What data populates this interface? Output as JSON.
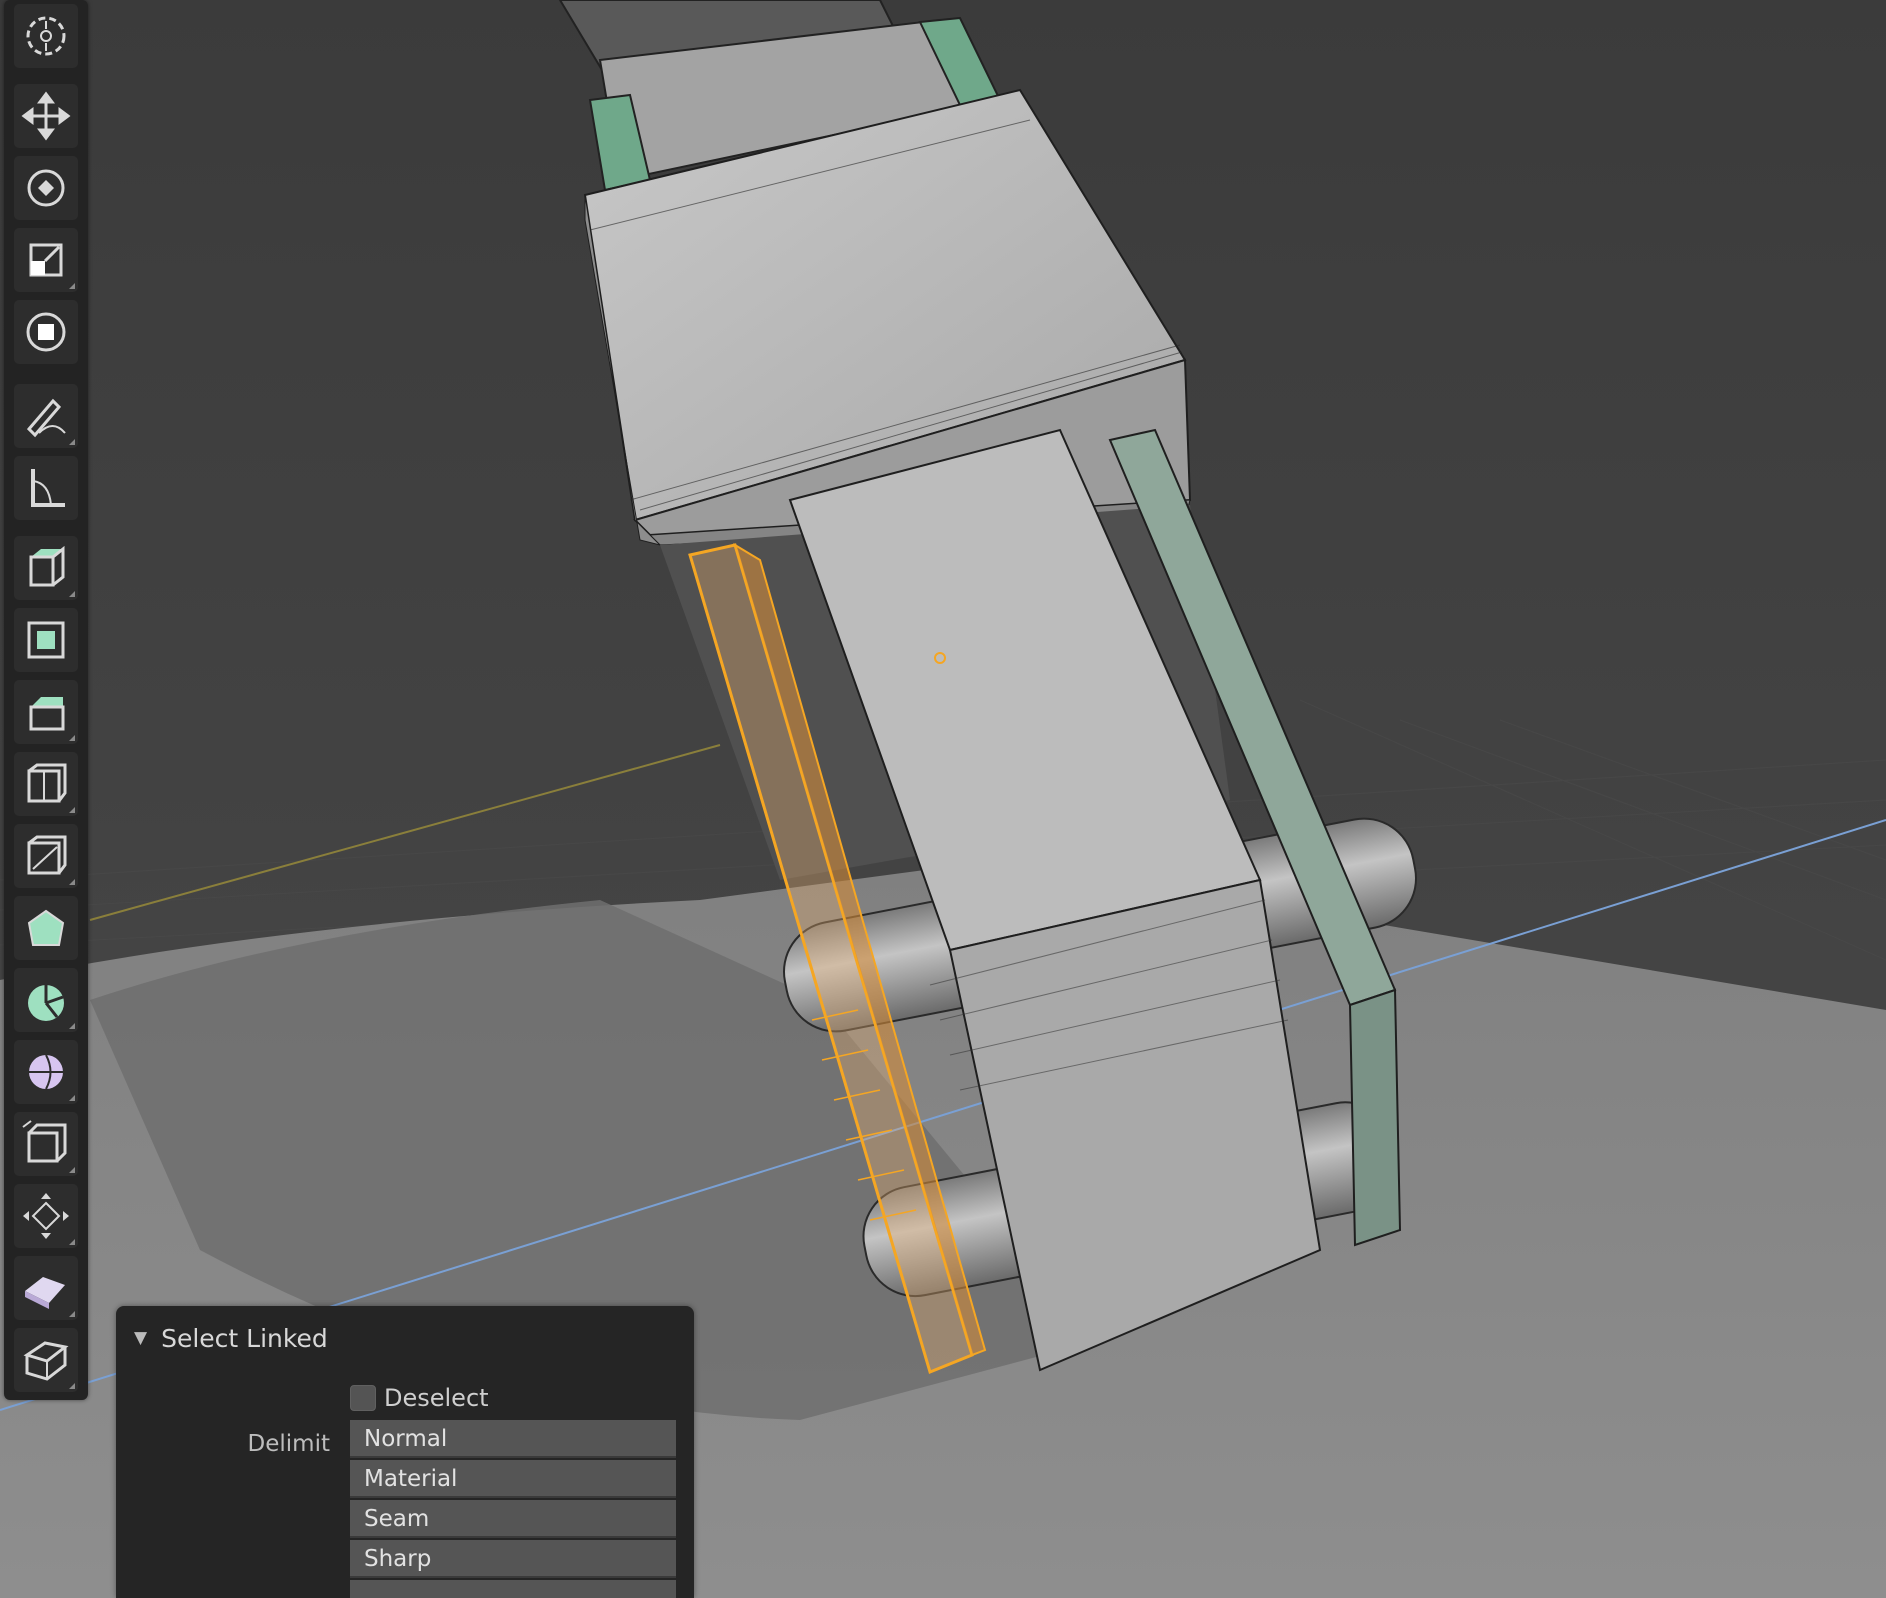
{
  "toolbar": {
    "tools": [
      {
        "name": "cursor-tool",
        "icon": "cursor-icon"
      },
      {
        "name": "move-tool",
        "icon": "move-icon"
      },
      {
        "name": "rotate-tool",
        "icon": "rotate-icon"
      },
      {
        "name": "scale-tool",
        "icon": "scale-icon"
      },
      {
        "name": "transform-tool",
        "icon": "transform-icon"
      },
      {
        "name": "annotate-tool",
        "icon": "annotate-icon"
      },
      {
        "name": "measure-tool",
        "icon": "measure-icon"
      },
      {
        "name": "extrude-region-tool",
        "icon": "extrude-icon"
      },
      {
        "name": "inset-faces-tool",
        "icon": "inset-icon"
      },
      {
        "name": "bevel-tool",
        "icon": "bevel-icon"
      },
      {
        "name": "loop-cut-tool",
        "icon": "loop-cut-icon"
      },
      {
        "name": "knife-tool",
        "icon": "knife-icon"
      },
      {
        "name": "poly-build-tool",
        "icon": "poly-build-icon"
      },
      {
        "name": "spin-tool",
        "icon": "spin-icon"
      },
      {
        "name": "smooth-tool",
        "icon": "smooth-icon"
      },
      {
        "name": "edge-slide-tool",
        "icon": "edge-slide-icon"
      },
      {
        "name": "shrink-fatten-tool",
        "icon": "shrink-fatten-icon"
      },
      {
        "name": "shear-tool",
        "icon": "shear-icon"
      },
      {
        "name": "rip-region-tool",
        "icon": "rip-region-icon"
      }
    ]
  },
  "operator_panel": {
    "title": "Select Linked",
    "deselect_label": "Deselect",
    "deselect_checked": false,
    "delimit_label": "Delimit",
    "delimit_options": [
      "Normal",
      "Material",
      "Seam",
      "Sharp"
    ]
  },
  "colors": {
    "viewport_bg": "#3d3d3d",
    "floor": "#8b8b8b",
    "mesh_face": "#bdbdbd",
    "selected_face": "#e6a050",
    "selection_outline": "#f5a623",
    "green_part": "#7fa58e",
    "x_axis": "#8a7f3b",
    "y_axis": "#7aa0d4"
  }
}
